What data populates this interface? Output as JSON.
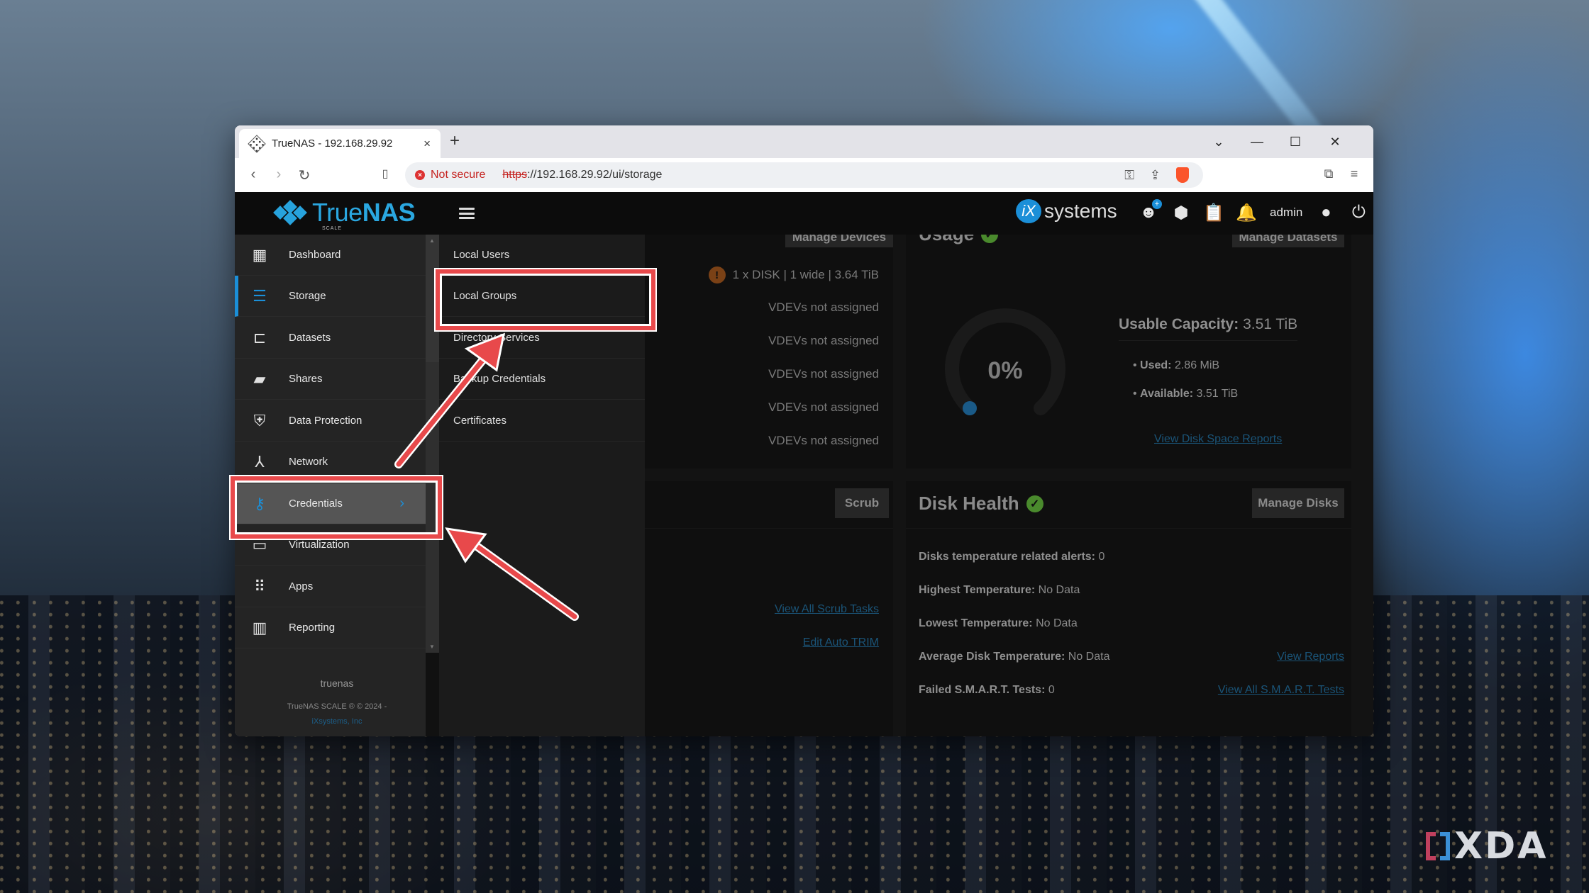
{
  "browser": {
    "tab_title": "TrueNAS - 192.168.29.92",
    "tab_close": "×",
    "new_tab": "+",
    "security_label": "Not secure",
    "url_scheme": "https",
    "url_rest": "://192.168.29.92/ui/storage",
    "controls": {
      "dropdown": "⌄",
      "minimize": "—",
      "maximize": "☐",
      "close": "✕"
    },
    "nav": {
      "back": "‹",
      "forward": "›",
      "reload": "↻",
      "bookmark": "🔖"
    }
  },
  "header": {
    "brand": "True",
    "brand_bold": "NAS",
    "edition": "SCALE",
    "ix_letter": "iX",
    "ix_text": "systems",
    "user": "admin"
  },
  "sidebar": {
    "items": [
      {
        "label": "Dashboard",
        "icon": "dashboard-icon"
      },
      {
        "label": "Storage",
        "icon": "storage-icon"
      },
      {
        "label": "Datasets",
        "icon": "datasets-icon"
      },
      {
        "label": "Shares",
        "icon": "shares-icon"
      },
      {
        "label": "Data Protection",
        "icon": "shield-icon"
      },
      {
        "label": "Network",
        "icon": "network-icon"
      },
      {
        "label": "Credentials",
        "icon": "key-icon"
      },
      {
        "label": "Virtualization",
        "icon": "laptop-icon"
      },
      {
        "label": "Apps",
        "icon": "apps-grid-icon"
      },
      {
        "label": "Reporting",
        "icon": "reporting-icon"
      }
    ],
    "active": "Storage",
    "expanded": "Credentials",
    "hostname": "truenas",
    "copyright": "TrueNAS SCALE ® © 2024 -",
    "company": "iXsystems, Inc"
  },
  "submenu": {
    "items": [
      {
        "label": "Local Users"
      },
      {
        "label": "Local Groups"
      },
      {
        "label": "Directory Services"
      },
      {
        "label": "Backup Credentials"
      },
      {
        "label": "Certificates"
      }
    ],
    "highlighted": "Local Groups"
  },
  "topology": {
    "manage_button": "Manage Devices",
    "rows": [
      "1 x DISK | 1 wide | 3.64 TiB",
      "VDEVs not assigned",
      "VDEVs not assigned",
      "VDEVs not assigned",
      "VDEVs not assigned",
      "VDEVs not assigned"
    ]
  },
  "usage": {
    "title": "Usage",
    "manage_button": "Manage Datasets",
    "percent_label": "0%",
    "percent_used": 0,
    "usable_label": "Usable Capacity:",
    "usable_value": "3.51 TiB",
    "used_label": "Used:",
    "used_value": "2.86 MiB",
    "available_label": "Available:",
    "available_value": "3.51 TiB",
    "report_link": "View Disk Space Reports"
  },
  "scrub": {
    "button": "Scrub",
    "link_tasks": "View All Scrub Tasks",
    "link_trim": "Edit Auto TRIM"
  },
  "disk_health": {
    "title": "Disk Health",
    "manage_button": "Manage Disks",
    "rows": [
      {
        "label": "Disks temperature related alerts:",
        "value": "0"
      },
      {
        "label": "Highest Temperature:",
        "value": "No Data"
      },
      {
        "label": "Lowest Temperature:",
        "value": "No Data"
      },
      {
        "label": "Average Disk Temperature:",
        "value": "No Data"
      },
      {
        "label": "Failed S.M.A.R.T. Tests:",
        "value": "0"
      }
    ],
    "link_reports": "View Reports",
    "link_smart": "View All S.M.A.R.T. Tests"
  },
  "watermark": {
    "text": "XDA"
  },
  "colors": {
    "accent": "#1b8fd8",
    "annotation": "#e8494b",
    "ok": "#4a8a2d",
    "warning": "#8a4a1a"
  }
}
